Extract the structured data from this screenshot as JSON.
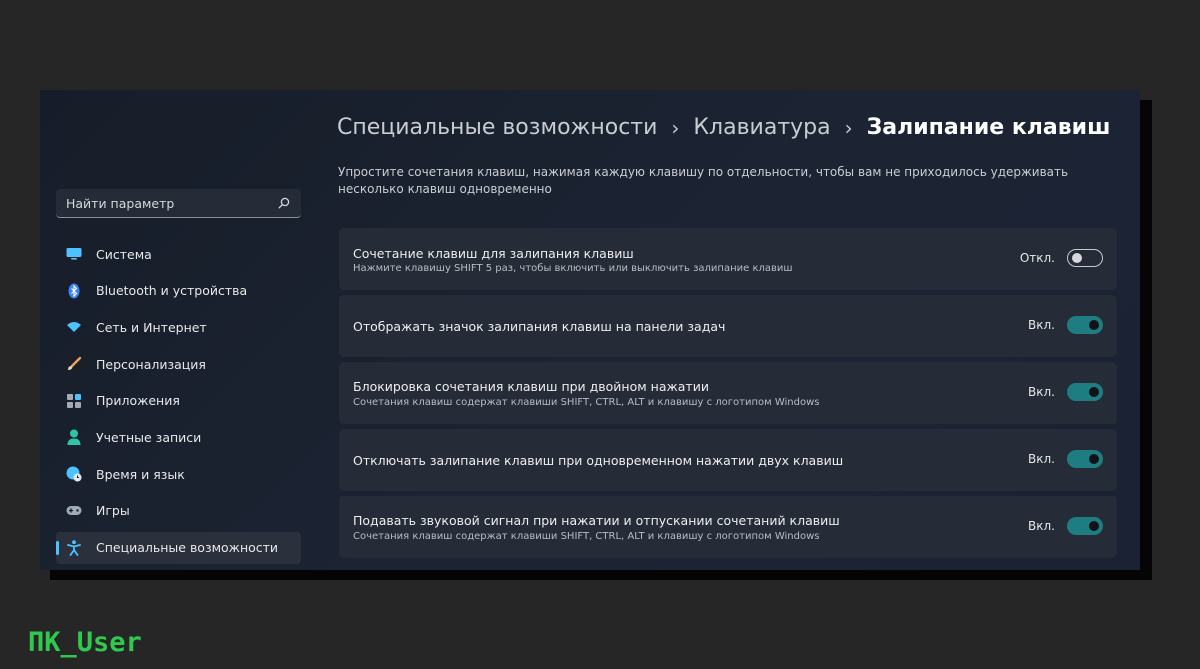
{
  "breadcrumb": [
    "Специальные возможности",
    "Клавиатура",
    "Залипание клавиш"
  ],
  "description": "Упростите сочетания клавиш, нажимая каждую клавишу по отдельности, чтобы вам не приходилось удерживать несколько клавиш одновременно",
  "search": {
    "placeholder": "Найти параметр",
    "icon": "search-icon"
  },
  "sidebar": {
    "items": [
      {
        "label": "Система",
        "icon": "monitor-icon",
        "color": "#4cc2ff"
      },
      {
        "label": "Bluetooth и устройства",
        "icon": "bluetooth-icon",
        "color": "#3b82f6"
      },
      {
        "label": "Сеть и Интернет",
        "icon": "wifi-icon",
        "color": "#4cc2ff"
      },
      {
        "label": "Персонализация",
        "icon": "brush-icon",
        "color": "#f0a15a"
      },
      {
        "label": "Приложения",
        "icon": "apps-icon",
        "color": "#a0aab8"
      },
      {
        "label": "Учетные записи",
        "icon": "user-icon",
        "color": "#2ec4a8"
      },
      {
        "label": "Время и язык",
        "icon": "globe-clock-icon",
        "color": "#4cc2ff"
      },
      {
        "label": "Игры",
        "icon": "gamepad-icon",
        "color": "#a0aab8"
      },
      {
        "label": "Специальные возможности",
        "icon": "accessibility-icon",
        "color": "#4cc2ff",
        "selected": true
      }
    ]
  },
  "settings": [
    {
      "title": "Сочетание клавиш для залипания клавиш",
      "subtitle": "Нажмите клавишу SHIFT 5 раз, чтобы включить или выключить залипание клавиш",
      "state": "Откл.",
      "on": false
    },
    {
      "title": "Отображать значок залипания клавиш на панели задач",
      "subtitle": "",
      "state": "Вкл.",
      "on": true
    },
    {
      "title": "Блокировка сочетания клавиш при двойном нажатии",
      "subtitle": "Сочетания клавиш содержат клавиши SHIFT, CTRL, ALT и клавишу с логотипом Windows",
      "state": "Вкл.",
      "on": true
    },
    {
      "title": "Отключать залипание клавиш при одновременном нажатии двух клавиш",
      "subtitle": "",
      "state": "Вкл.",
      "on": true
    },
    {
      "title": "Подавать звуковой сигнал при нажатии и отпускании сочетаний клавиш",
      "subtitle": "Сочетания клавиш содержат клавиши SHIFT, CTRL, ALT и клавишу с логотипом Windows",
      "state": "Вкл.",
      "on": true
    }
  ],
  "watermark": "ПК_User",
  "colors": {
    "accent": "#4cc2ff",
    "toggle_on": "#1d7d80",
    "watermark": "#2fc94e"
  }
}
